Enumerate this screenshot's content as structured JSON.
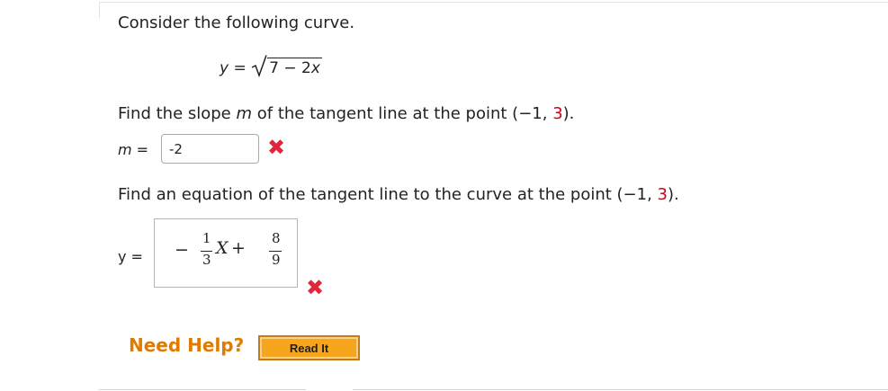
{
  "intro": "Consider the following curve.",
  "curve": {
    "lhs": "y",
    "equals": "=",
    "radicand_const": "7",
    "radicand_op": "−",
    "radicand_coeff": "2",
    "radicand_var": "x"
  },
  "question1": {
    "prefix": "Find the slope ",
    "var": "m",
    "suffix": " of the tangent line at the point (−1, ",
    "point_y": "3",
    "end": ")."
  },
  "answer1": {
    "label_var": "m",
    "label_eq": " =",
    "value": "-2",
    "status": "incorrect"
  },
  "question2": {
    "prefix": "Find an equation of the tangent line to the curve at the point (−1, ",
    "point_y": "3",
    "end": ")."
  },
  "answer2": {
    "label": "y =",
    "minus": "−",
    "frac1_num": "1",
    "frac1_den": "3",
    "var": "X",
    "plus": "+",
    "frac2_num": "8",
    "frac2_den": "9",
    "status": "incorrect"
  },
  "help": {
    "label": "Need Help?",
    "button": "Read It"
  },
  "marks": {
    "incorrect": "✖"
  },
  "colors": {
    "accent_red": "#d0021b",
    "help_orange": "#e07b00",
    "button_orange": "#f6a61c"
  }
}
